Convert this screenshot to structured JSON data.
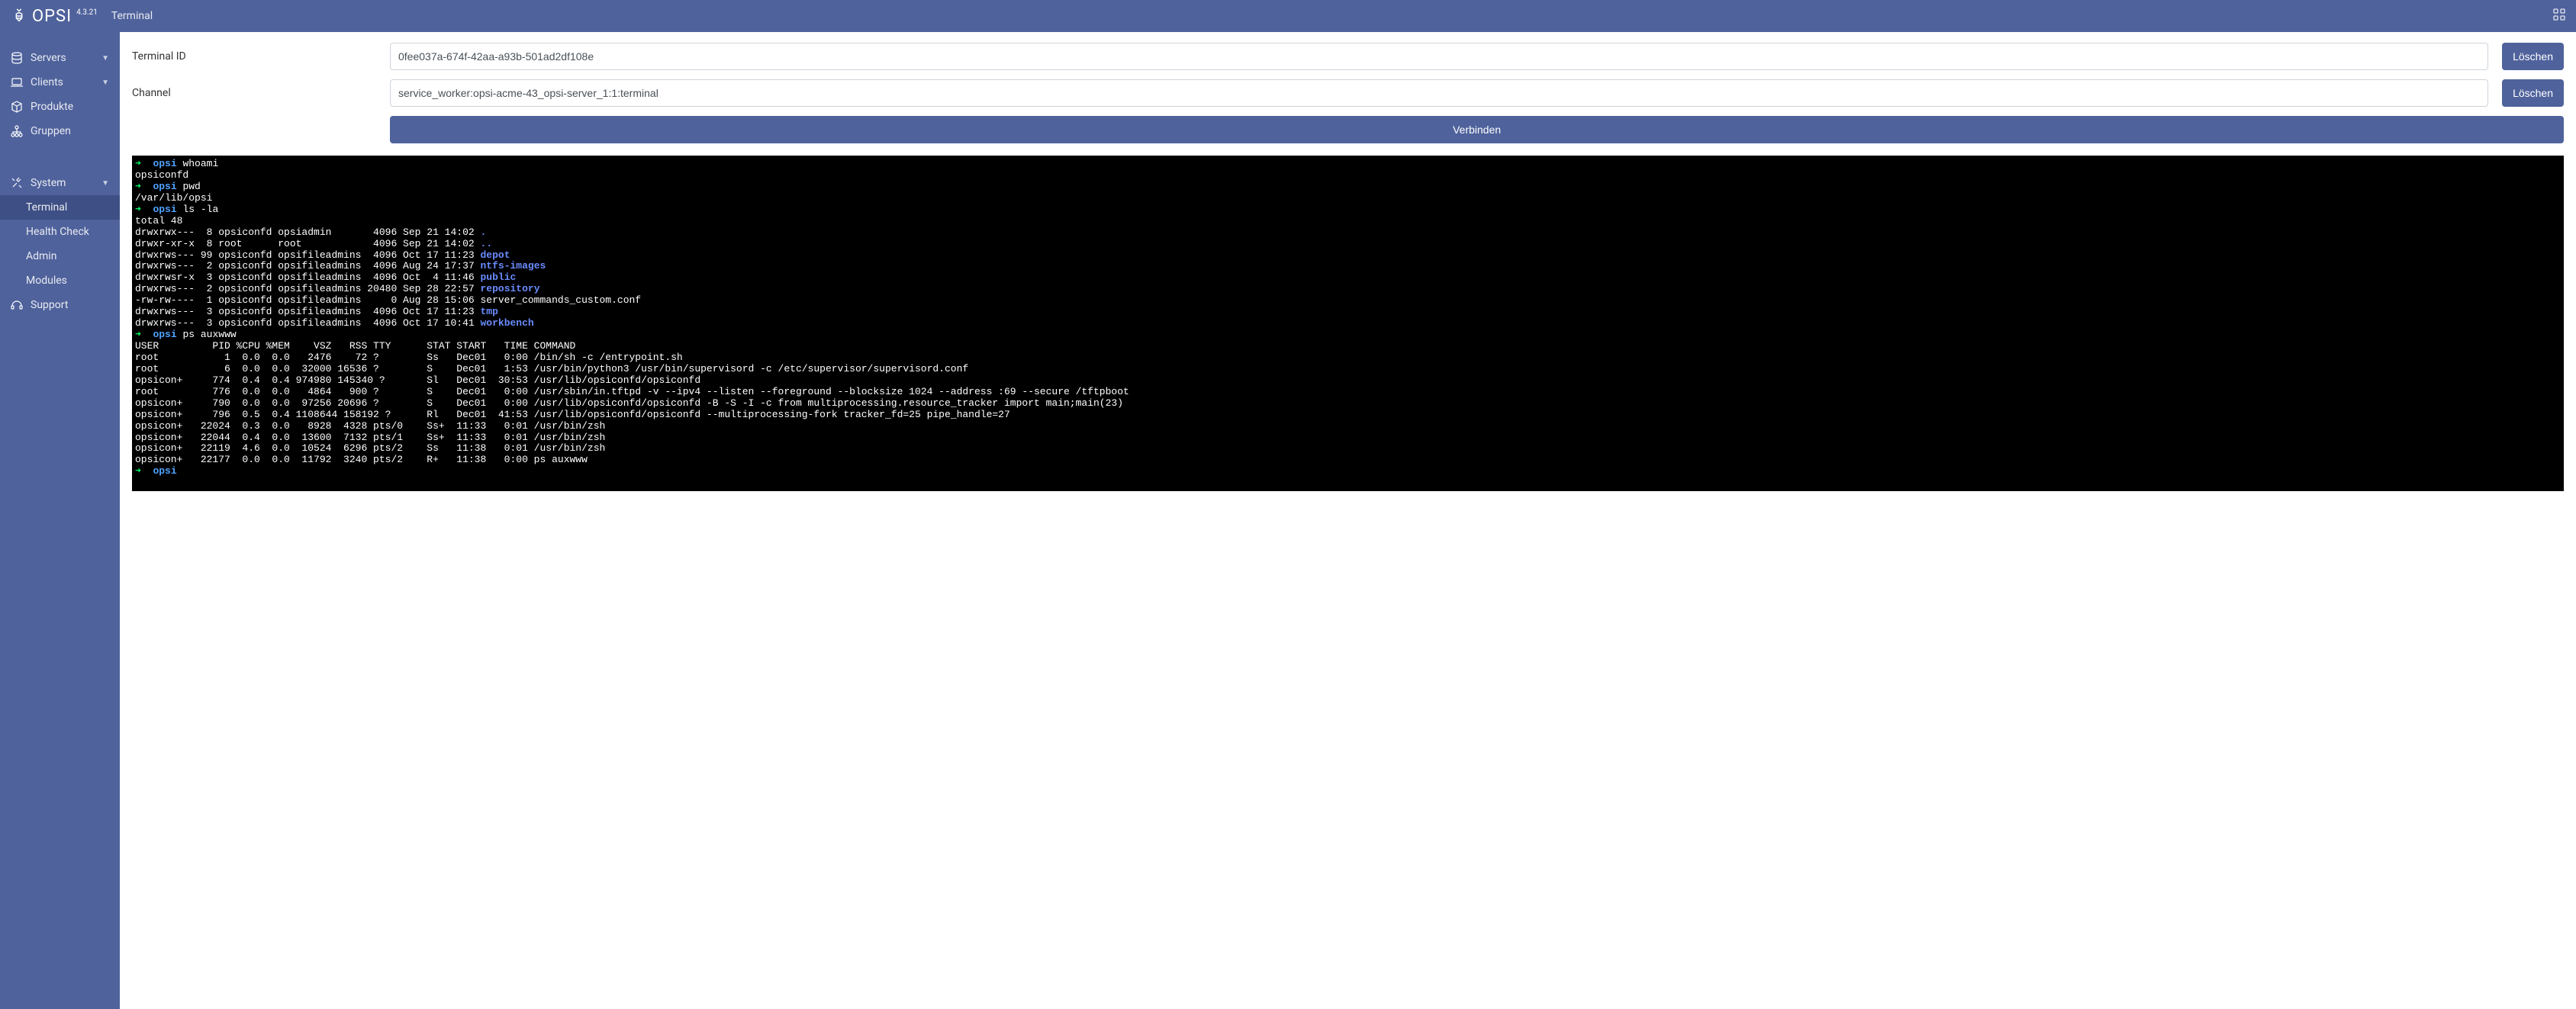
{
  "brand": {
    "name": "OPSI",
    "version": "4.3.21"
  },
  "header": {
    "page_title": "Terminal"
  },
  "sidebar": {
    "servers": "Servers",
    "clients": "Clients",
    "products": "Produkte",
    "groups": "Gruppen",
    "system": "System",
    "system_sub": {
      "terminal": "Terminal",
      "health_check": "Health Check",
      "admin": "Admin",
      "modules": "Modules"
    },
    "support": "Support"
  },
  "form": {
    "terminal_id_label": "Terminal ID",
    "terminal_id_value": "0fee037a-674f-42aa-a93b-501ad2df108e",
    "channel_label": "Channel",
    "channel_value": "service_worker:opsi-acme-43_opsi-server_1:1:terminal",
    "delete_label": "Löschen",
    "connect_label": "Verbinden"
  },
  "terminal_output": {
    "l01_arrow": "➜  ",
    "l01_host": "opsi",
    "l01_cmd": " whoami",
    "l02": "opsiconfd",
    "l03_arrow": "➜  ",
    "l03_host": "opsi",
    "l03_cmd": " pwd",
    "l04": "/var/lib/opsi",
    "l05_arrow": "➜  ",
    "l05_host": "opsi",
    "l05_cmd": " ls -la",
    "l06": "total 48",
    "l07a": "drwxrwx---  8 opsiconfd opsiadmin       4096 Sep 21 14:02 ",
    "l07b": ".",
    "l08a": "drwxr-xr-x  8 root      root            4096 Sep 21 14:02 ",
    "l08b": "..",
    "l09a": "drwxrws--- 99 opsiconfd opsifileadmins  4096 Oct 17 11:23 ",
    "l09b": "depot",
    "l10a": "drwxrws---  2 opsiconfd opsifileadmins  4096 Aug 24 17:37 ",
    "l10b": "ntfs-images",
    "l11a": "drwxrwsr-x  3 opsiconfd opsifileadmins  4096 Oct  4 11:46 ",
    "l11b": "public",
    "l12a": "drwxrws---  2 opsiconfd opsifileadmins 20480 Sep 28 22:57 ",
    "l12b": "repository",
    "l13": "-rw-rw----  1 opsiconfd opsifileadmins     0 Aug 28 15:06 server_commands_custom.conf",
    "l14a": "drwxrws---  3 opsiconfd opsifileadmins  4096 Oct 17 11:23 ",
    "l14b": "tmp",
    "l15a": "drwxrws---  3 opsiconfd opsifileadmins  4096 Oct 17 10:41 ",
    "l15b": "workbench",
    "l16_arrow": "➜  ",
    "l16_host": "opsi",
    "l16_cmd": " ps auxwww",
    "l17": "USER         PID %CPU %MEM    VSZ   RSS TTY      STAT START   TIME COMMAND",
    "l18": "root           1  0.0  0.0   2476    72 ?        Ss   Dec01   0:00 /bin/sh -c /entrypoint.sh",
    "l19": "root           6  0.0  0.0  32000 16536 ?        S    Dec01   1:53 /usr/bin/python3 /usr/bin/supervisord -c /etc/supervisor/supervisord.conf",
    "l20": "opsicon+     774  0.4  0.4 974980 145340 ?       Sl   Dec01  30:53 /usr/lib/opsiconfd/opsiconfd",
    "l21": "root         776  0.0  0.0   4864   900 ?        S    Dec01   0:00 /usr/sbin/in.tftpd -v --ipv4 --listen --foreground --blocksize 1024 --address :69 --secure /tftpboot",
    "l22": "opsicon+     790  0.0  0.0  97256 20696 ?        S    Dec01   0:00 /usr/lib/opsiconfd/opsiconfd -B -S -I -c from multiprocessing.resource_tracker import main;main(23)",
    "l23": "opsicon+     796  0.5  0.4 1108644 158192 ?      Rl   Dec01  41:53 /usr/lib/opsiconfd/opsiconfd --multiprocessing-fork tracker_fd=25 pipe_handle=27",
    "l24": "opsicon+   22024  0.3  0.0   8928  4328 pts/0    Ss+  11:33   0:01 /usr/bin/zsh",
    "l25": "opsicon+   22044  0.4  0.0  13600  7132 pts/1    Ss+  11:33   0:01 /usr/bin/zsh",
    "l26": "opsicon+   22119  4.6  0.0  10524  6296 pts/2    Ss   11:38   0:01 /usr/bin/zsh",
    "l27": "opsicon+   22177  0.0  0.0  11792  3240 pts/2    R+   11:38   0:00 ps auxwww",
    "l28_arrow": "➜  ",
    "l28_host": "opsi"
  }
}
